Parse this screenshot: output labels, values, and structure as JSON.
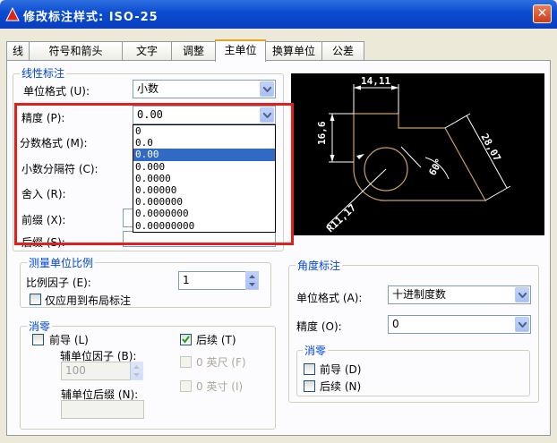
{
  "window": {
    "title": "修改标注样式: ISO-25",
    "close": "✕"
  },
  "tabs": [
    "线",
    "符号和箭头",
    "文字",
    "调整",
    "主单位",
    "换算单位",
    "公差"
  ],
  "linear": {
    "group_title": "线性标注",
    "unit_format_label": "单位格式 (U):",
    "unit_format_value": "小数",
    "precision_label": "精度 (P):",
    "precision_value": "0.00",
    "fraction_format_label": "分数格式 (M):",
    "decimal_sep_label": "小数分隔符 (C):",
    "round_label": "舍入 (R):",
    "prefix_label": "前缀 (X):",
    "suffix_label": "后缀 (S):"
  },
  "precision_options": [
    "0",
    "0.0",
    "0.00",
    "0.000",
    "0.0000",
    "0.00000",
    "0.000000",
    "0.0000000",
    "0.00000000"
  ],
  "precision_selected_index": 2,
  "scale": {
    "group_title": "测量单位比例",
    "factor_label": "比例因子 (E):",
    "factor_value": "1",
    "layout_only_label": "仅应用到布局标注"
  },
  "zero_suppress": {
    "group_title": "消零",
    "leading_label": "前导 (L)",
    "trailing_label": "后续 (T)",
    "sub_factor_label": "辅单位因子 (B):",
    "sub_factor_value": "100",
    "sub_suffix_label": "辅单位后缀 (N):",
    "feet_label": "0 英尺 (F)",
    "inch_label": "0 英寸 (I)"
  },
  "angular": {
    "group_title": "角度标注",
    "unit_format_label": "单位格式 (A):",
    "unit_format_value": "十进制度数",
    "precision_label": "精度 (O):",
    "precision_value": "0",
    "zero_group_title": "消零",
    "leading_label": "前导 (D)",
    "trailing_label": "后续 (N)"
  },
  "preview": {
    "dim_top": "14,11",
    "dim_left": "16,6",
    "dim_right": "28,07",
    "dim_angle": "60°",
    "dim_radius": "R11,17",
    "line_color": "#c9a064",
    "text_color": "#ffffff"
  }
}
